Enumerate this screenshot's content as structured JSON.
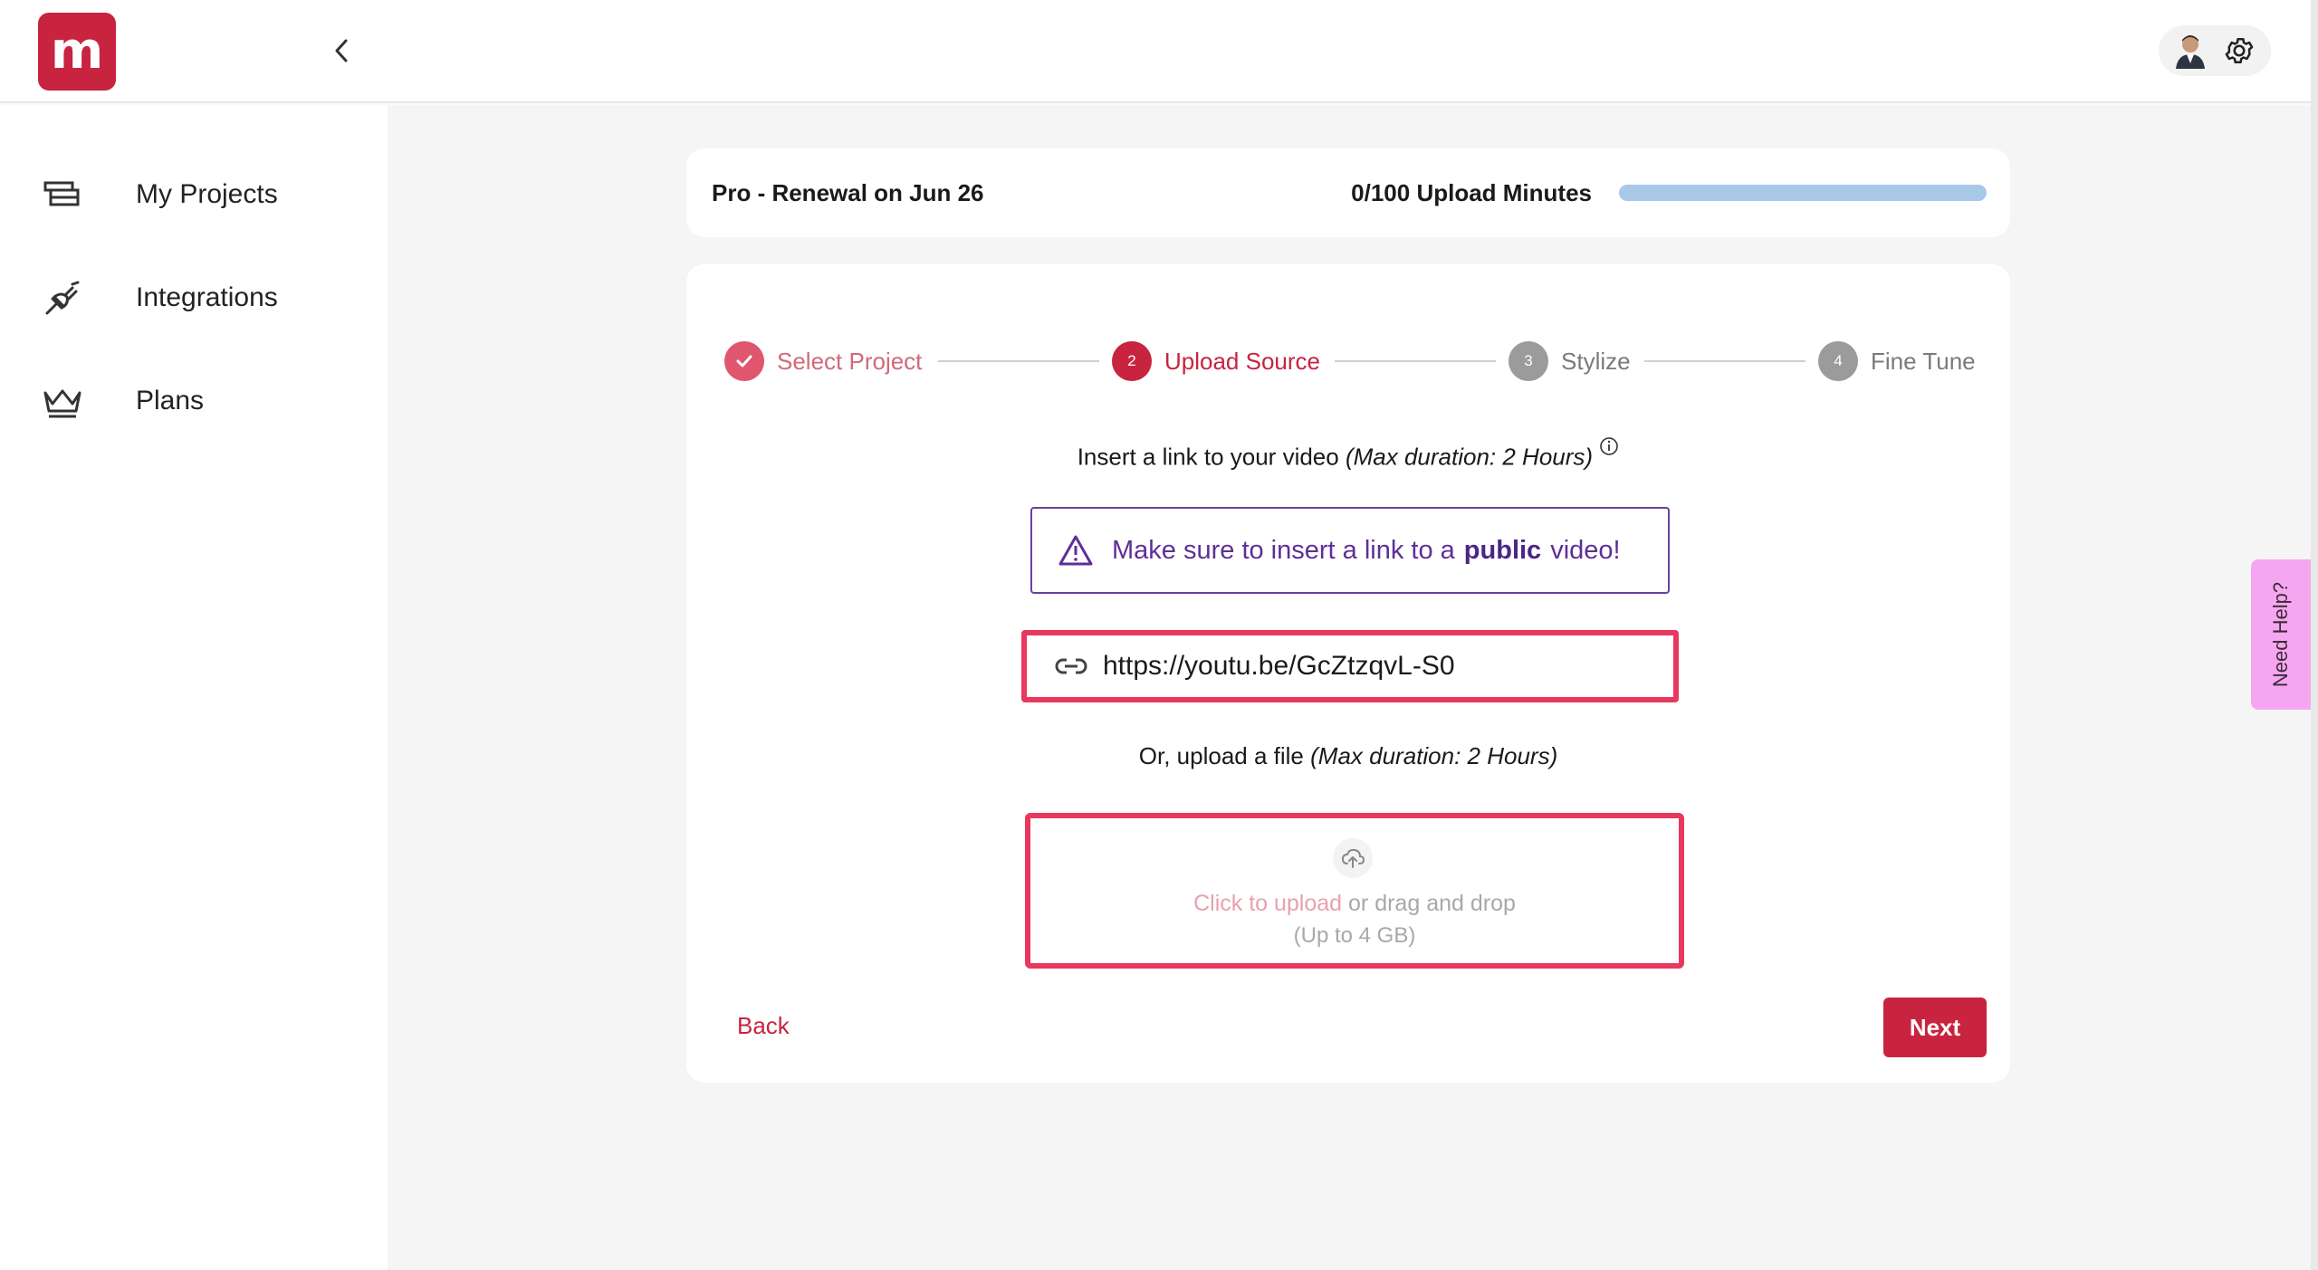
{
  "brand": {
    "logo_letter": "m",
    "color": "#c8233f"
  },
  "sidebar": {
    "items": [
      {
        "label": "My Projects",
        "icon": "stack-icon"
      },
      {
        "label": "Integrations",
        "icon": "plug-icon"
      },
      {
        "label": "Plans",
        "icon": "crown-icon"
      }
    ]
  },
  "plan_card": {
    "plan_text": "Pro - Renewal on Jun 26",
    "minutes_text": "0/100 Upload Minutes",
    "progress_fraction": 0.0
  },
  "steps": [
    {
      "num": "",
      "label": "Select Project",
      "state": "done"
    },
    {
      "num": "2",
      "label": "Upload Source",
      "state": "active"
    },
    {
      "num": "3",
      "label": "Stylize",
      "state": "pending"
    },
    {
      "num": "4",
      "label": "Fine Tune",
      "state": "pending"
    }
  ],
  "form": {
    "insert_text": "Insert a link to your video",
    "insert_note": "(Max duration: 2 Hours)",
    "warning_prefix": "Make sure to insert a link to a",
    "warning_bold": "public",
    "warning_suffix": "video!",
    "url_value": "https://youtu.be/GcZtzqvL-S0",
    "or_text": "Or, upload a file",
    "or_note": "(Max duration: 2 Hours)",
    "upload_link": "Click to upload",
    "upload_rest": "or drag and drop",
    "upload_limit": "(Up to 4 GB)"
  },
  "actions": {
    "back": "Back",
    "next": "Next"
  },
  "help_tab": "Need Help?"
}
